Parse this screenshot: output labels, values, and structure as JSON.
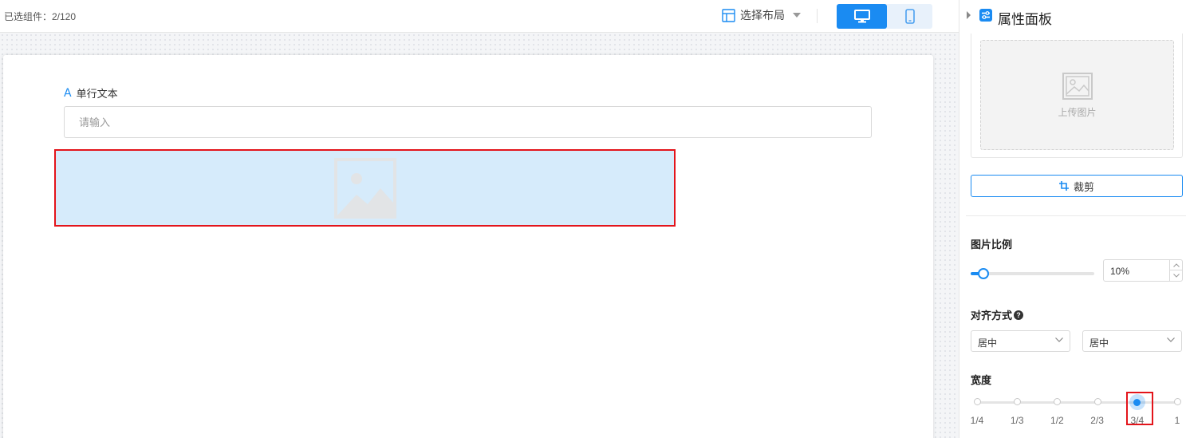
{
  "topbar": {
    "selected_label": "已选组件：2/120",
    "layout_select_label": "选择布局",
    "icons": {
      "layout": "layout-icon",
      "caret": "caret-down-icon",
      "desktop": "desktop-icon",
      "mobile": "mobile-icon"
    }
  },
  "form": {
    "field_label": "单行文本",
    "field_icon": "A",
    "input_placeholder": "请输入",
    "input_value": ""
  },
  "panel": {
    "title": "属性面板",
    "upload_text": "上传图片",
    "crop_label": "裁剪",
    "ratio": {
      "label": "图片比例",
      "value": "10%",
      "fraction": 0.1
    },
    "align": {
      "label": "对齐方式",
      "horizontal": "居中",
      "vertical": "居中"
    },
    "width": {
      "label": "宽度",
      "stops": [
        "1/4",
        "1/3",
        "1/2",
        "2/3",
        "3/4",
        "1"
      ],
      "selected": "3/4"
    }
  },
  "colors": {
    "accent": "#1a8bf2",
    "highlight": "#e3141b",
    "selection_fill": "#d6ebfb"
  }
}
